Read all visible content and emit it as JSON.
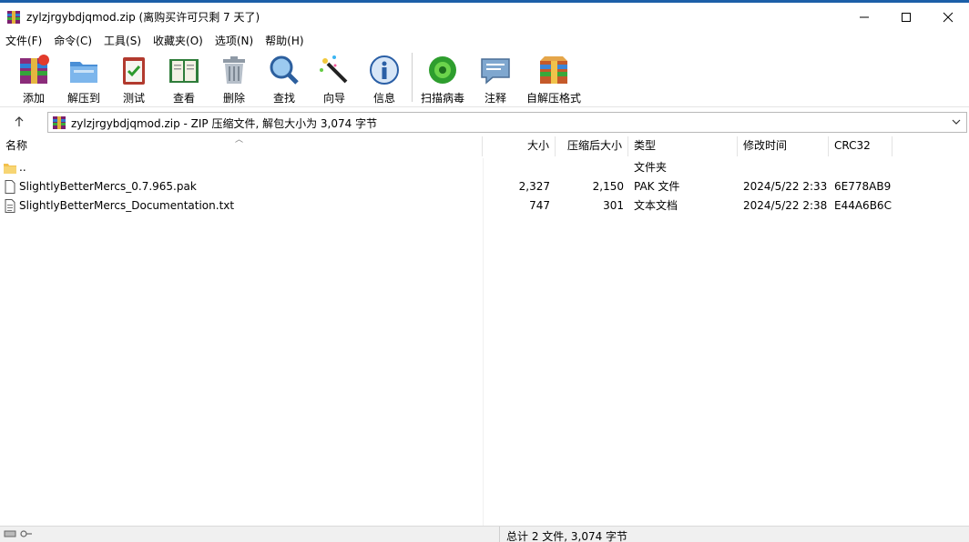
{
  "window": {
    "title": "zylzjrgybdjqmod.zip (离购买许可只剩 7 天了)",
    "icons": {
      "app": "winrar-app-icon",
      "minimize": "minimize-icon",
      "maximize": "maximize-icon",
      "close": "close-icon"
    }
  },
  "menu": [
    "文件(F)",
    "命令(C)",
    "工具(S)",
    "收藏夹(O)",
    "选项(N)",
    "帮助(H)"
  ],
  "toolbar": [
    {
      "label": "添加",
      "icon": "add-archive-icon"
    },
    {
      "label": "解压到",
      "icon": "extract-folder-icon"
    },
    {
      "label": "测试",
      "icon": "test-clipboard-icon"
    },
    {
      "label": "查看",
      "icon": "view-book-icon"
    },
    {
      "label": "删除",
      "icon": "trash-icon"
    },
    {
      "label": "查找",
      "icon": "magnifier-icon"
    },
    {
      "label": "向导",
      "icon": "wizard-wand-icon"
    },
    {
      "label": "信息",
      "icon": "info-icon"
    },
    {
      "label": "扫描病毒",
      "icon": "virus-scan-icon"
    },
    {
      "label": "注释",
      "icon": "comment-icon"
    },
    {
      "label": "自解压格式",
      "icon": "sfx-archive-icon"
    }
  ],
  "address": {
    "up_icon": "up-arrow-icon",
    "text": "zylzjrgybdjqmod.zip - ZIP 压缩文件, 解包大小为 3,074 字节",
    "dropdown_icon": "chevron-down-icon"
  },
  "columns": [
    "名称",
    "大小",
    "压缩后大小",
    "类型",
    "修改时间",
    "CRC32"
  ],
  "files": [
    {
      "name": "..",
      "size": "",
      "packed": "",
      "type": "文件夹",
      "modified": "",
      "crc": "",
      "icon": "folder-icon"
    },
    {
      "name": "SlightlyBetterMercs_0.7.965.pak",
      "size": "2,327",
      "packed": "2,150",
      "type": "PAK 文件",
      "modified": "2024/5/22 2:33",
      "crc": "6E778AB9",
      "icon": "file-icon"
    },
    {
      "name": "SlightlyBetterMercs_Documentation.txt",
      "size": "747",
      "packed": "301",
      "type": "文本文档",
      "modified": "2024/5/22 2:38",
      "crc": "E44A6B6C",
      "icon": "text-file-icon"
    }
  ],
  "status": {
    "total": "总计 2 文件, 3,074 字节",
    "left_icons": [
      "drive-icon",
      "key-icon"
    ]
  },
  "colors": {
    "title_border": "#1c5fa8",
    "statusbar": "#f0f0f0"
  }
}
